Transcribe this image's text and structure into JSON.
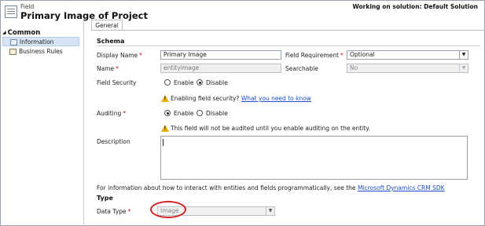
{
  "header": {
    "kind": "Field",
    "title": "Primary Image of Project",
    "solution_note": "Working on solution: Default Solution"
  },
  "nav": {
    "group": "Common",
    "items": [
      {
        "label": "Information",
        "selected": true
      },
      {
        "label": "Business Rules",
        "selected": false
      }
    ]
  },
  "tabs": [
    {
      "label": "General"
    }
  ],
  "schema": {
    "heading": "Schema",
    "display_name_label": "Display Name",
    "display_name_value": "Primary Image",
    "field_requirement_label": "Field Requirement",
    "field_requirement_value": "Optional",
    "name_label": "Name",
    "name_value": "entityimage",
    "searchable_label": "Searchable",
    "searchable_value": "No",
    "field_security_label": "Field Security",
    "field_security_options": {
      "enable": "Enable",
      "disable": "Disable"
    },
    "field_security_selected": "Disable",
    "field_security_warning": "Enabling field security?",
    "field_security_link": "What you need to know",
    "auditing_label": "Auditing",
    "auditing_options": {
      "enable": "Enable",
      "disable": "Disable"
    },
    "auditing_selected": "Enable",
    "auditing_warning": "This field will not be audited until you enable auditing on the entity.",
    "description_label": "Description",
    "description_value": ""
  },
  "info": {
    "text": "For information about how to interact with entities and fields programmatically, see the",
    "link": "Microsoft Dynamics CRM SDK"
  },
  "type": {
    "heading": "Type",
    "data_type_label": "Data Type",
    "data_type_value": "Image"
  },
  "colors": {
    "required": "#d0102a",
    "link": "#1b4fc2",
    "highlight_oval": "#d21f1f",
    "nav_selected": "#d6e4f5"
  }
}
